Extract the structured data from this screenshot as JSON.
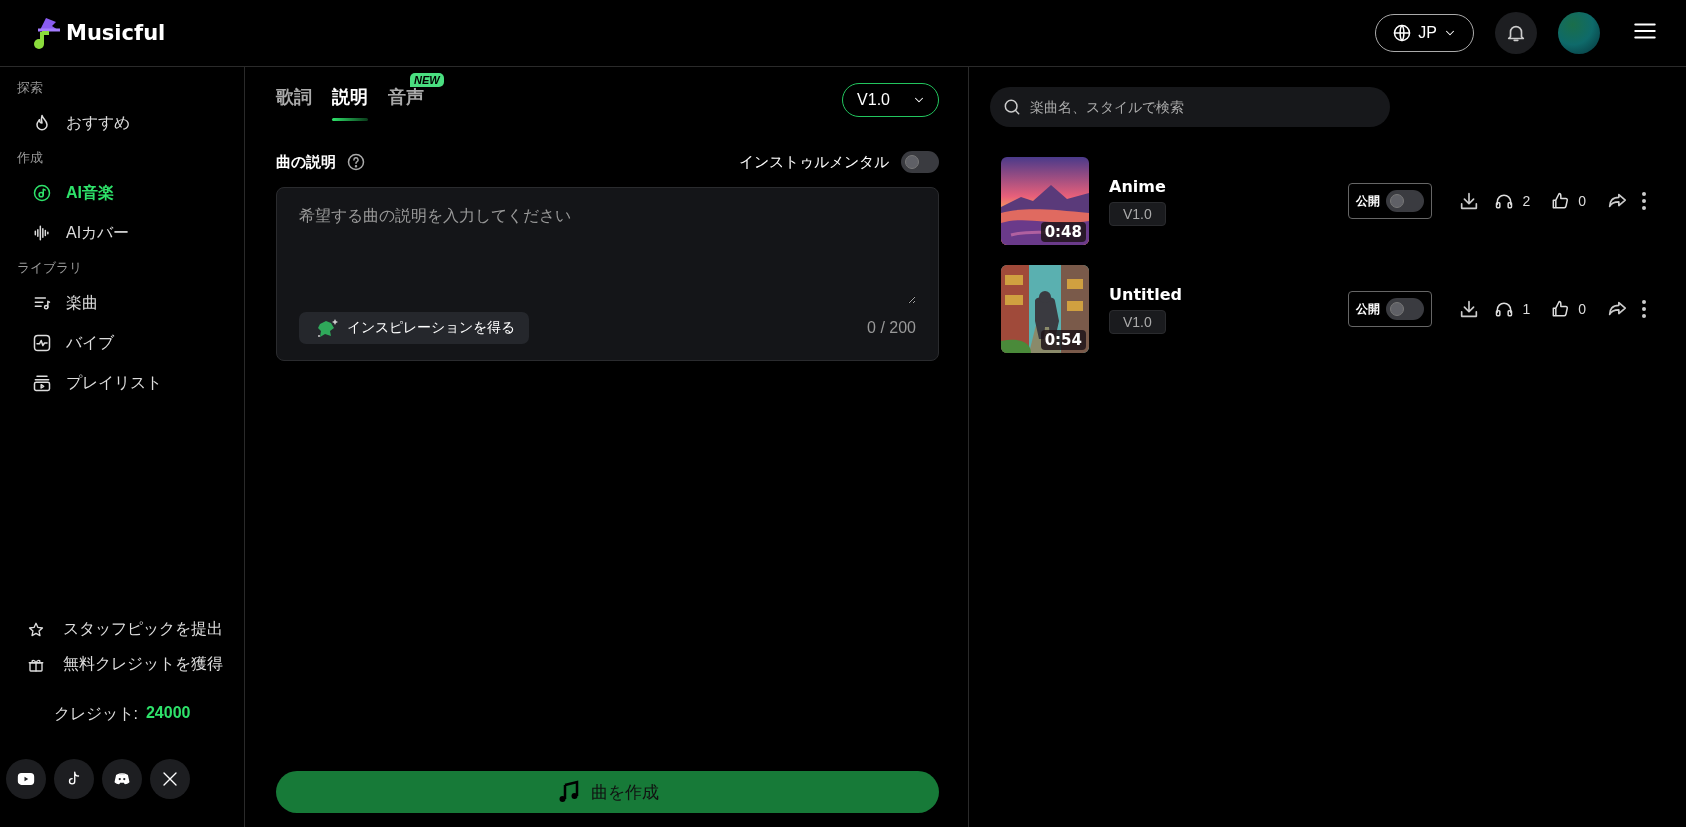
{
  "header": {
    "logo": "Musicful",
    "language": "JP"
  },
  "sidebar": {
    "sections": [
      {
        "title": "探索",
        "items": [
          {
            "label": "おすすめ",
            "selected": false
          }
        ]
      },
      {
        "title": "作成",
        "items": [
          {
            "label": "AI音楽",
            "selected": true
          },
          {
            "label": "AIカバー",
            "selected": false
          }
        ]
      },
      {
        "title": "ライブラリ",
        "items": [
          {
            "label": "楽曲",
            "selected": false
          },
          {
            "label": "バイブ",
            "selected": false
          },
          {
            "label": "プレイリスト",
            "selected": false
          }
        ]
      }
    ],
    "footer_links": [
      "スタッフピックを提出",
      "無料クレジットを獲得"
    ],
    "credits": {
      "label": "クレジット:",
      "value": "24000"
    }
  },
  "composer": {
    "tabs": [
      {
        "label": "歌詞",
        "selected": false
      },
      {
        "label": "説明",
        "selected": true
      },
      {
        "label": "音声",
        "selected": false,
        "badge": "NEW"
      }
    ],
    "version": "V1.0",
    "label": "曲の説明",
    "instrumental": {
      "label": "インストゥルメンタル",
      "on": false
    },
    "placeholder": "希望する曲の説明を入力してください",
    "inspire_button": "インスピレーションを得る",
    "counter": "0 / 200",
    "create_button": "曲を作成"
  },
  "library": {
    "search": {
      "placeholder": "楽曲名、スタイルで検索"
    },
    "songs": [
      {
        "title": "Anime",
        "version": "V1.0",
        "duration": "0:48",
        "public_label": "公開",
        "public": false,
        "listens": "2",
        "likes": "0"
      },
      {
        "title": "Untitled",
        "version": "V1.0",
        "duration": "0:54",
        "public_label": "公開",
        "public": false,
        "listens": "1",
        "likes": "0"
      }
    ]
  }
}
